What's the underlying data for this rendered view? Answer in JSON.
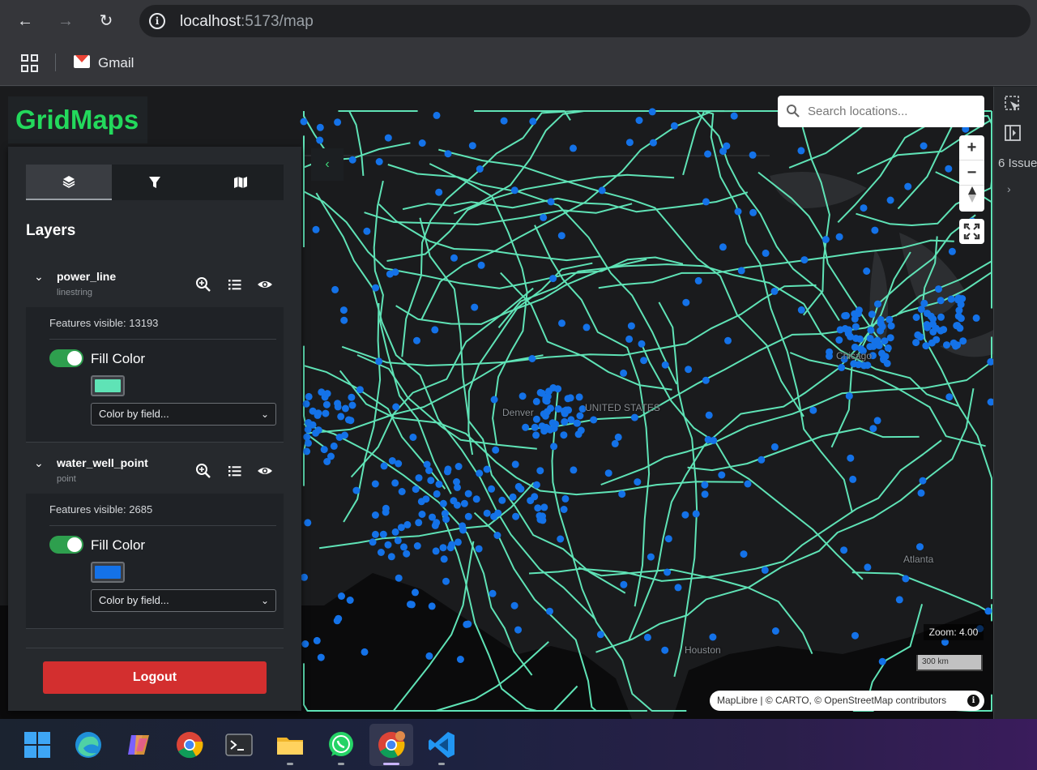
{
  "browser": {
    "url_host": "localhost",
    "url_path": ":5173/map",
    "bookmark_label": "Gmail"
  },
  "app": {
    "brand": "GridMaps",
    "panel_title": "Layers",
    "tabs": [
      {
        "icon": "layers-icon",
        "active": true
      },
      {
        "icon": "filter-icon",
        "active": false
      },
      {
        "icon": "map-icon",
        "active": false
      }
    ],
    "layers": [
      {
        "name": "power_line",
        "type": "linestring",
        "features_visible": "Features visible: 13193",
        "fill_label": "Fill Color",
        "fill_enabled": true,
        "fill_color": "#5fe3b6",
        "color_by_placeholder": "Color by field..."
      },
      {
        "name": "water_well_point",
        "type": "point",
        "features_visible": "Features visible: 2685",
        "fill_label": "Fill Color",
        "fill_enabled": true,
        "fill_color": "#1472e8",
        "color_by_placeholder": "Color by field..."
      }
    ],
    "logout_label": "Logout"
  },
  "map": {
    "search_placeholder": "Search locations...",
    "zoom_readout": "Zoom: 4.00",
    "scale_label": "300 km",
    "attribution": {
      "maplibre": "MapLibre",
      "carto": " | © CARTO, © ",
      "osm": "OpenStreetMap",
      "suffix": " contributors"
    },
    "place_labels": [
      "UNITED STATES",
      "Denver",
      "Chicago",
      "Atlanta",
      "Houston"
    ]
  },
  "devtools": {
    "issues_label": "6 Issue"
  },
  "colors": {
    "brand_green": "#23d95c",
    "power_line": "#5fe3b6",
    "water_well": "#1472e8",
    "logout_red": "#d32f2f"
  }
}
